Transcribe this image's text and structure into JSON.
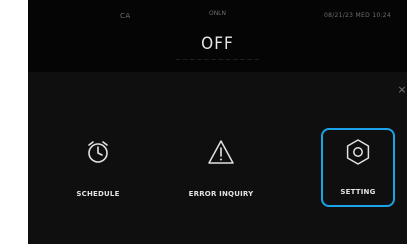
{
  "status_bar": {
    "left_text": "CA",
    "center_text": "ONLN",
    "right_text": "08/21/23 MED 10:24"
  },
  "state": {
    "title": "OFF",
    "subtitle": "— — — — — — — — — — — —"
  },
  "close_glyph": "×",
  "menu": {
    "schedule_label": "SCHEDULE",
    "error_label": "ERROR INQUIRY",
    "setting_label": "SETTING"
  },
  "colors": {
    "screen_bg": "#0f0f0f",
    "highlight": "#1aa3e8",
    "text": "#e2e2e2"
  },
  "icons": {
    "schedule": "alarm-clock-icon",
    "error": "warning-triangle-icon",
    "setting": "hexagon-gear-icon"
  }
}
